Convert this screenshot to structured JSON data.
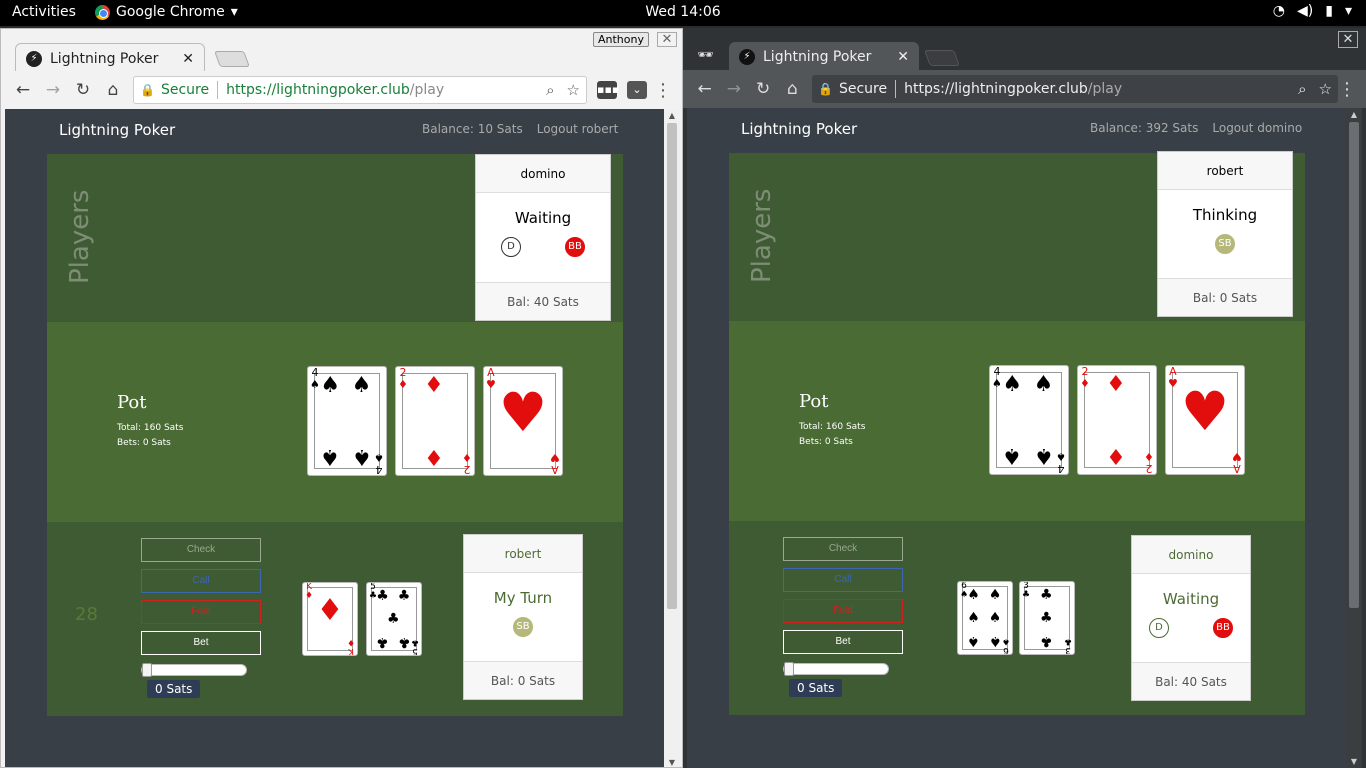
{
  "os_bar": {
    "activities": "Activities",
    "app": "Google Chrome",
    "clock": "Wed 14:06"
  },
  "left": {
    "tab_title": "Lightning Poker",
    "profile": "Anthony",
    "secure": "Secure",
    "url_host": "https://lightningpoker.club",
    "url_path": "/play",
    "app_title": "Lightning Poker",
    "balance": "Balance: 10 Sats",
    "logout": "Logout robert",
    "players_label": "Players",
    "opponent": {
      "name": "domino",
      "status": "Waiting",
      "chip1": "D",
      "chip2": "BB",
      "balance": "Bal: 40 Sats"
    },
    "pot": {
      "title": "Pot",
      "total": "Total: 160 Sats",
      "bets": "Bets: 0 Sats"
    },
    "board": [
      {
        "rank": "4",
        "suit": "♠",
        "color": "black"
      },
      {
        "rank": "2",
        "suit": "♦",
        "color": "red"
      },
      {
        "rank": "A",
        "suit": "♥",
        "color": "red"
      }
    ],
    "actions": {
      "check": "Check",
      "call": "Call",
      "fold": "Fold",
      "bet": "Bet",
      "sats": "0 Sats",
      "timer": "28"
    },
    "hand": [
      {
        "rank": "K",
        "suit": "♦",
        "color": "red"
      },
      {
        "rank": "5",
        "suit": "♣",
        "color": "black"
      }
    ],
    "me": {
      "name": "robert",
      "status": "My Turn",
      "chip": "SB",
      "balance": "Bal: 0 Sats"
    }
  },
  "right": {
    "tab_title": "Lightning Poker",
    "secure": "Secure",
    "url_host": "https://lightningpoker.club",
    "url_path": "/play",
    "app_title": "Lightning Poker",
    "balance": "Balance: 392 Sats",
    "logout": "Logout domino",
    "players_label": "Players",
    "opponent": {
      "name": "robert",
      "status": "Thinking",
      "chip": "SB",
      "balance": "Bal: 0 Sats"
    },
    "pot": {
      "title": "Pot",
      "total": "Total: 160 Sats",
      "bets": "Bets: 0 Sats"
    },
    "board": [
      {
        "rank": "4",
        "suit": "♠",
        "color": "black"
      },
      {
        "rank": "2",
        "suit": "♦",
        "color": "red"
      },
      {
        "rank": "A",
        "suit": "♥",
        "color": "red"
      }
    ],
    "actions": {
      "check": "Check",
      "call": "Call",
      "fold": "Fold",
      "bet": "Bet",
      "sats": "0 Sats"
    },
    "hand": [
      {
        "rank": "6",
        "suit": "♠",
        "color": "black"
      },
      {
        "rank": "3",
        "suit": "♣",
        "color": "black"
      }
    ],
    "me": {
      "name": "domino",
      "status": "Waiting",
      "chip1": "D",
      "chip2": "BB",
      "balance": "Bal: 40 Sats"
    }
  },
  "colors": {
    "felt_dark": "#3f5b34",
    "felt_light": "#4b6b34",
    "page_bg": "#393f46",
    "big_blind": "#e20d0d",
    "small_blind": "#b5b87a"
  }
}
